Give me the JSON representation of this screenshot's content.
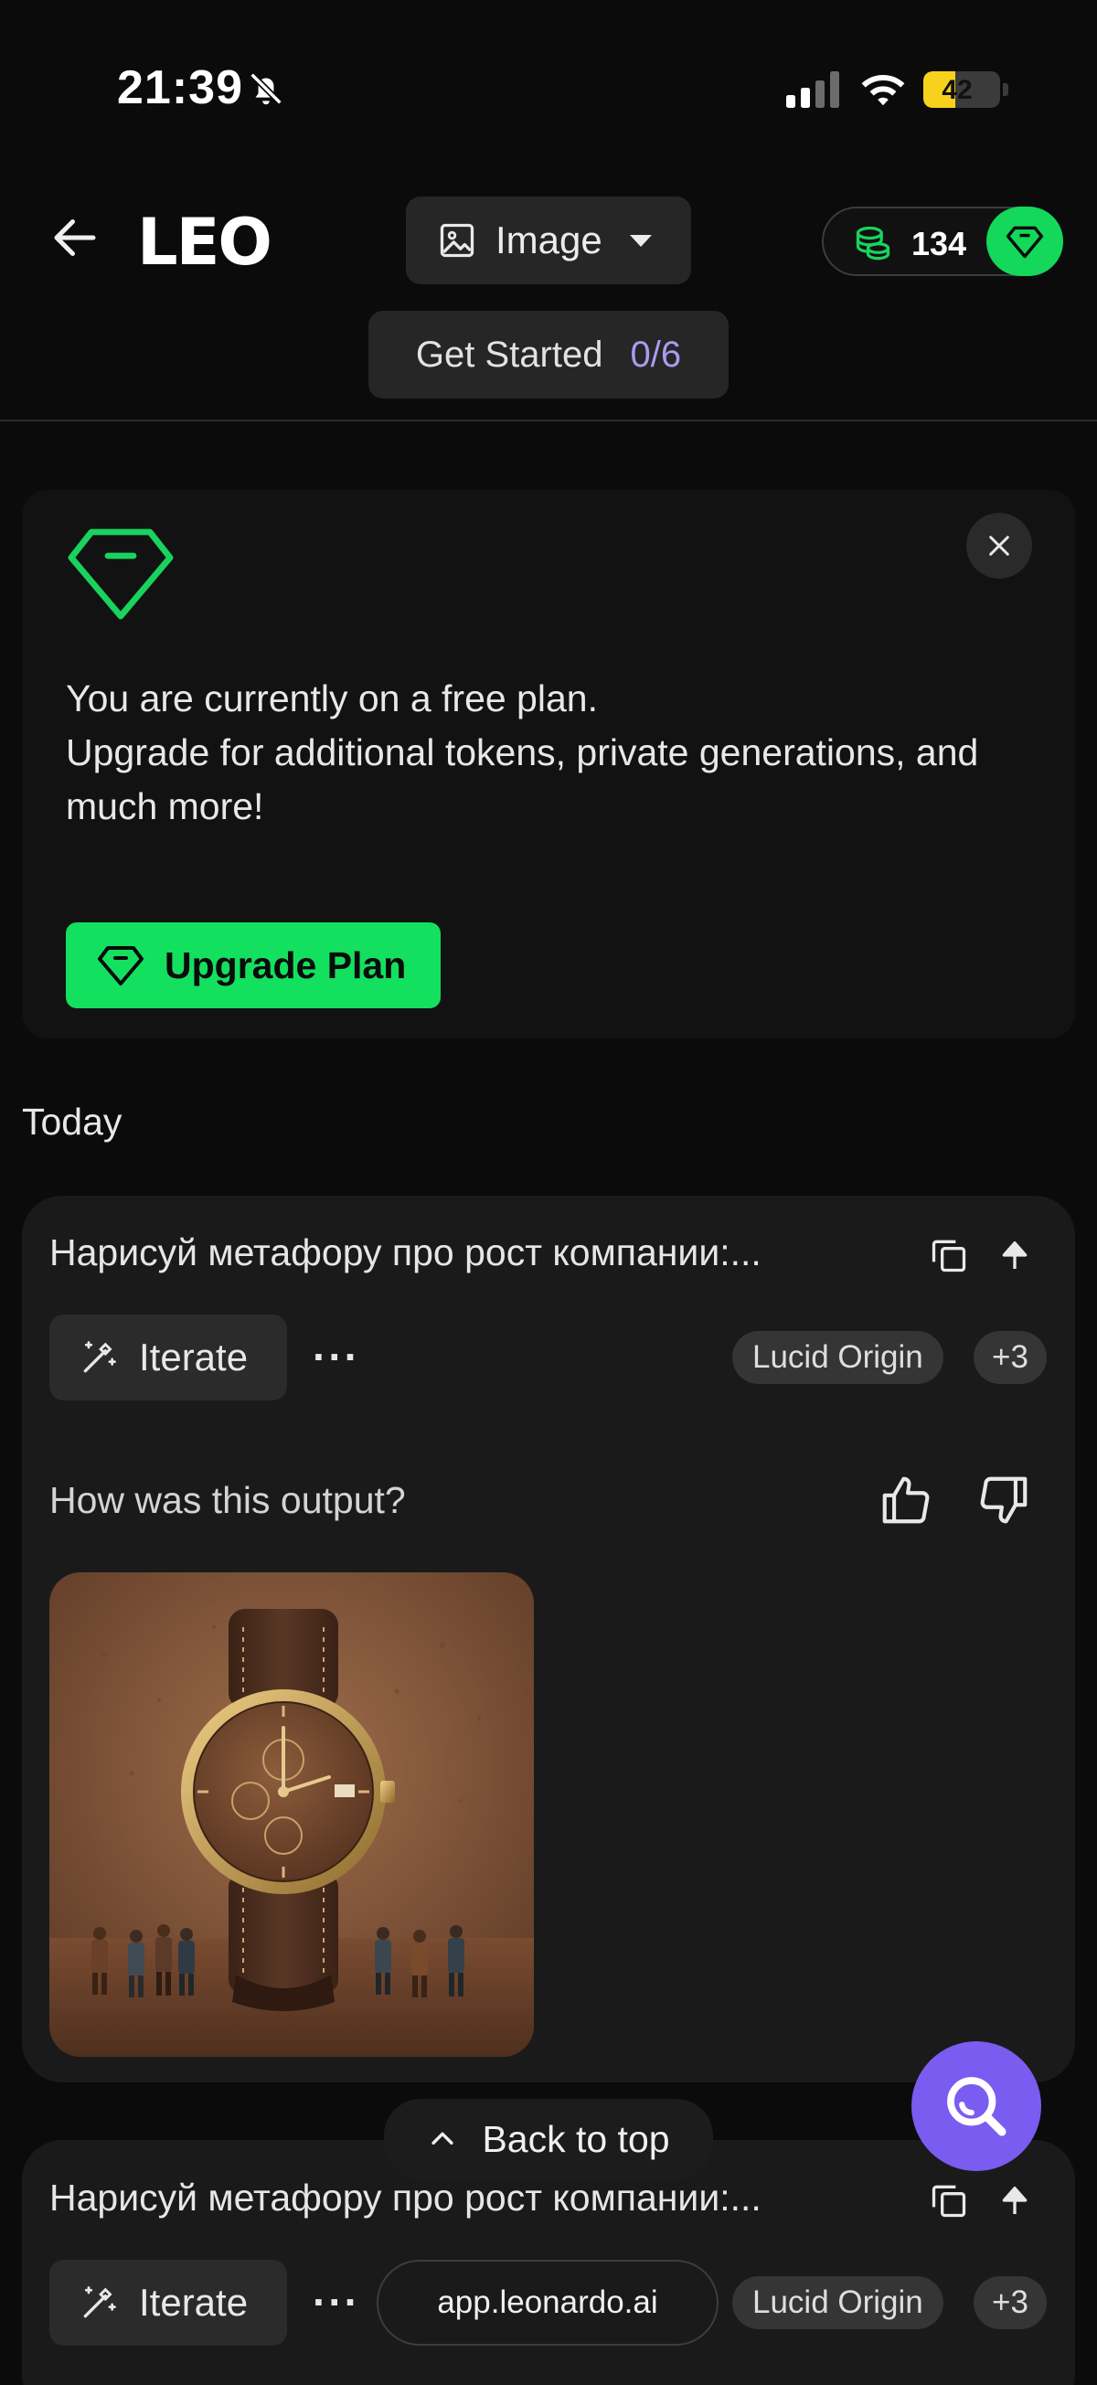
{
  "status_bar": {
    "time": "21:39",
    "battery_level": 42,
    "battery_text": "42"
  },
  "header": {
    "logo": "LEO",
    "mode_label": "Image",
    "tokens": "134",
    "get_started_label": "Get Started",
    "get_started_progress": "0/6"
  },
  "upgrade_card": {
    "line1": "You are currently on a free plan.",
    "line2": "Upgrade for additional tokens, private generations, and much more!",
    "button_label": "Upgrade Plan"
  },
  "section_label": "Today",
  "generations": [
    {
      "prompt": "Нарисуй метафору про рост компании:...",
      "iterate_label": "Iterate",
      "more": "···",
      "model": "Lucid Origin",
      "extra_models": "+3",
      "feedback_question": "How was this output?"
    },
    {
      "prompt": "Нарисуй метафору про рост компании:...",
      "iterate_label": "Iterate",
      "more": "···",
      "model": "Lucid Origin",
      "extra_models": "+3"
    }
  ],
  "url_pill": "app.leonardo.ai",
  "back_to_top": "Back to top",
  "colors": {
    "accent_green": "#13e05e",
    "accent_purple": "#7a5cf0",
    "progress_purple": "#a79cf0",
    "battery_yellow": "#f7d21c"
  },
  "icons": [
    "bell-off-icon",
    "signal-icon",
    "wifi-icon",
    "battery-icon",
    "back-arrow-icon",
    "image-icon",
    "coins-icon",
    "diamond-icon",
    "close-icon",
    "copy-icon",
    "arrow-up-icon",
    "magic-wand-icon",
    "thumbs-up-icon",
    "thumbs-down-icon",
    "chevron-up-icon",
    "search-icon"
  ]
}
